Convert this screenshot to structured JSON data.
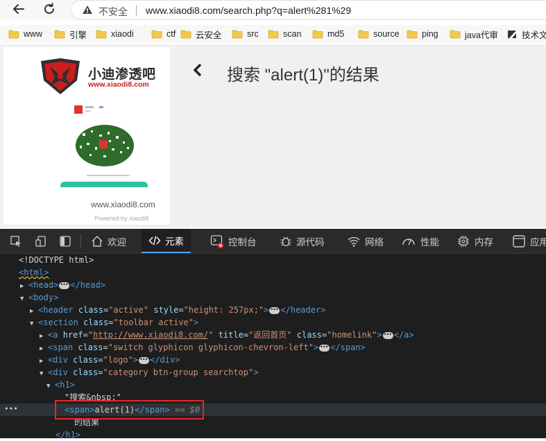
{
  "address_bar": {
    "insecure_label": "不安全",
    "url": "www.xiaodi8.com/search.php?q=alert%281%29"
  },
  "bookmarks": [
    {
      "label": "www"
    },
    {
      "label": "引擎"
    },
    {
      "label": "xiaodi"
    },
    {
      "label": "ctf"
    },
    {
      "label": "云安全"
    },
    {
      "label": "src"
    },
    {
      "label": "scan"
    },
    {
      "label": "md5"
    },
    {
      "label": "source"
    },
    {
      "label": "ping"
    },
    {
      "label": "java代审"
    },
    {
      "label": "技术文"
    }
  ],
  "page": {
    "logo_title": "小迪渗透吧",
    "logo_url": "www.xiaodi8.com",
    "site_url": "www.xiaodi8.com",
    "powered": "Powered by xiaodi8",
    "search_title": "搜索 \"alert(1)\"的结果"
  },
  "devtools": {
    "tabs": [
      {
        "label": "欢迎"
      },
      {
        "label": "元素"
      },
      {
        "label": "控制台"
      },
      {
        "label": "源代码"
      },
      {
        "label": "网络"
      },
      {
        "label": "性能"
      },
      {
        "label": "内存"
      },
      {
        "label": "应用"
      }
    ],
    "dom": {
      "doctype": "<!DOCTYPE html>",
      "html_tag": "<html>",
      "head_open": "<head>",
      "head_close": "</head>",
      "body_open": "<body>",
      "header_tag": "header",
      "header_class": "\"active\"",
      "header_style": "\"height: 257px;\"",
      "header_close": "</header>",
      "section_tag": "section",
      "section_class": "\"toolbar active\"",
      "a_href": "http://www.xiaodi8.com/",
      "a_title": "\"返回首页\"",
      "a_class": "\"homelink\"",
      "a_close": "</a>",
      "span_class": "\"switch glyphicon glyphicon-chevron-left\"",
      "span_close": "</span>",
      "div_logo_class": "\"logo\"",
      "div_close": "</div>",
      "div_cat_class": "\"category btn-group searchtop\"",
      "h1_open": "<h1>",
      "text_1": "\"搜索&nbsp;\"",
      "span_open": "<span>",
      "span_text": "alert(1)",
      "span_end": "</span>",
      "eq_dollar": "== $0",
      "text_2": "的结果",
      "h1_close": "</h1>"
    }
  },
  "colors": {
    "accent": "#4aa3ff",
    "highlight": "#e8262a",
    "logo_red": "#cc1d1d",
    "qr_green": "#2dc29d"
  }
}
